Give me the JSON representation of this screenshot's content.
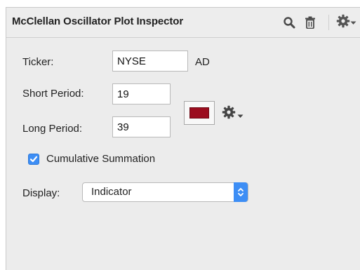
{
  "header": {
    "title": "McClellan Oscillator Plot Inspector",
    "icons": [
      "search-icon",
      "trash-icon",
      "gear-icon",
      "chevron-down-icon"
    ]
  },
  "form": {
    "ticker_label": "Ticker:",
    "ticker_value": "NYSE",
    "ticker_suffix": "AD",
    "short_period_label": "Short Period:",
    "short_period_value": "19",
    "long_period_label": "Long Period:",
    "long_period_value": "39",
    "plot_color": "#9b0d1f",
    "cumulative_label": "Cumulative Summation",
    "cumulative_checked": true,
    "display_label": "Display:",
    "display_value": "Indicator"
  },
  "colors": {
    "accent": "#3d8ef5",
    "panel_bg": "#ececec"
  }
}
